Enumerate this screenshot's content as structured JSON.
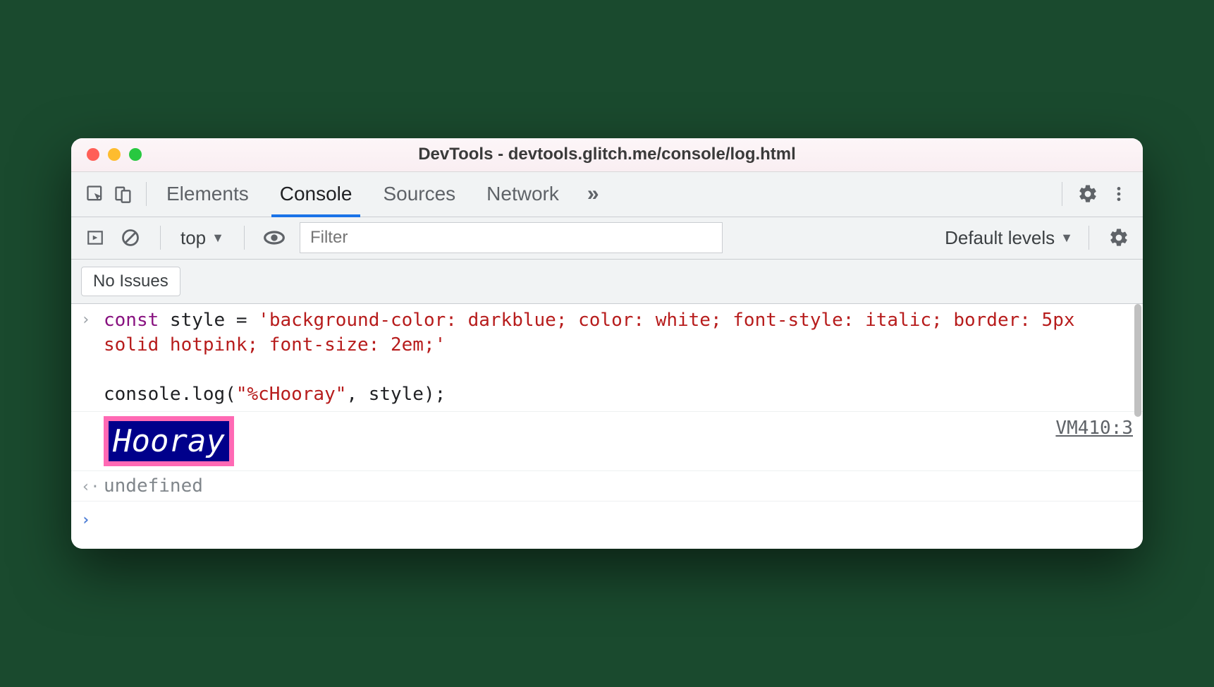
{
  "window": {
    "title": "DevTools - devtools.glitch.me/console/log.html"
  },
  "tabs": {
    "items": [
      "Elements",
      "Console",
      "Sources",
      "Network"
    ],
    "active": "Console"
  },
  "subbar": {
    "context": "top",
    "filter_placeholder": "Filter",
    "levels": "Default levels"
  },
  "issues": {
    "label": "No Issues"
  },
  "console": {
    "input_code_html": "<span class='kw'>const</span> style = <span class='str'>'background-color: darkblue; color: white; font-style: italic; border: 5px solid hotpink; font-size: 2em;'</span>\n\nconsole.log(<span class='str'>\"%cHooray\"</span>, style);",
    "styled_output": "Hooray",
    "source_link": "VM410:3",
    "return_value": "undefined"
  }
}
